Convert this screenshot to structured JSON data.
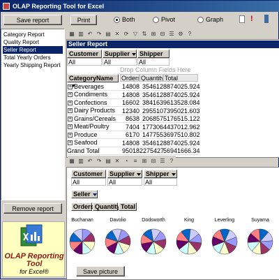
{
  "window": {
    "title": "OLAP Reporting Tool for Excel"
  },
  "buttons": {
    "save_report": "Save report",
    "print": "Print",
    "remove_report": "Remove report",
    "save_picture": "Save picture"
  },
  "view_mode": {
    "options": [
      "Both",
      "Pivot",
      "Graph"
    ],
    "selected": "Both"
  },
  "reports": [
    {
      "label": "Category Report",
      "selected": false
    },
    {
      "label": "Quality Report",
      "selected": false
    },
    {
      "label": "Seller Report",
      "selected": true
    },
    {
      "label": "Total Yearly Orders",
      "selected": false
    },
    {
      "label": "Yearly Shipping Report",
      "selected": false
    }
  ],
  "logo": {
    "line1": "OLAP Reporting",
    "line2": "Tool",
    "line3": "for Excel®"
  },
  "pivot": {
    "title": "Seller Report",
    "filters": [
      {
        "name": "Customer",
        "value": "All"
      },
      {
        "name": "Supplier",
        "value": "All"
      },
      {
        "name": "Shipper",
        "value": "All"
      }
    ],
    "drop_hint": "Drop Column Fields Here",
    "row_field": "CategoryName",
    "columns": [
      "Orders",
      "Quantity",
      "Total"
    ],
    "rows": [
      {
        "label": "Beverages",
        "orders": "14808",
        "quantity": "354612",
        "total": "8874025.924"
      },
      {
        "label": "Condiments",
        "orders": "14808",
        "quantity": "354612",
        "total": "8874025.924"
      },
      {
        "label": "Confections",
        "orders": "16602",
        "quantity": "384163",
        "total": "9613528.084"
      },
      {
        "label": "Dairy Products",
        "orders": "12340",
        "quantity": "295510",
        "total": "7395021.603"
      },
      {
        "label": "Grains/Cereals",
        "orders": "8638",
        "quantity": "206857",
        "total": "5176515.122"
      },
      {
        "label": "Meat/Poultry",
        "orders": "7404",
        "quantity": "177306",
        "total": "4437012.962"
      },
      {
        "label": "Produce",
        "orders": "6170",
        "quantity": "147755",
        "total": "3697510.802"
      },
      {
        "label": "Seafood",
        "orders": "14808",
        "quantity": "354612",
        "total": "8874025.924"
      },
      {
        "label": "Grand Total",
        "orders": "95018",
        "quantity": "2275427",
        "total": "56941666.34"
      }
    ]
  },
  "chart": {
    "filters": [
      {
        "name": "Customer",
        "value": "All"
      },
      {
        "name": "Supplier",
        "value": "All"
      },
      {
        "name": "Shipper",
        "value": "All"
      }
    ],
    "series_field": "Seller",
    "data_fields": [
      "Orders",
      "Quantity",
      "Total"
    ],
    "sellers": [
      "Buchanan",
      "Davolio",
      "Dodsworth",
      "King",
      "Leverling",
      "Suyama"
    ],
    "slice_colors": [
      "#9999ff",
      "#993366",
      "#ffffcc",
      "#ccffff",
      "#660066",
      "#ff8080",
      "#0066cc",
      "#ccccff"
    ]
  }
}
